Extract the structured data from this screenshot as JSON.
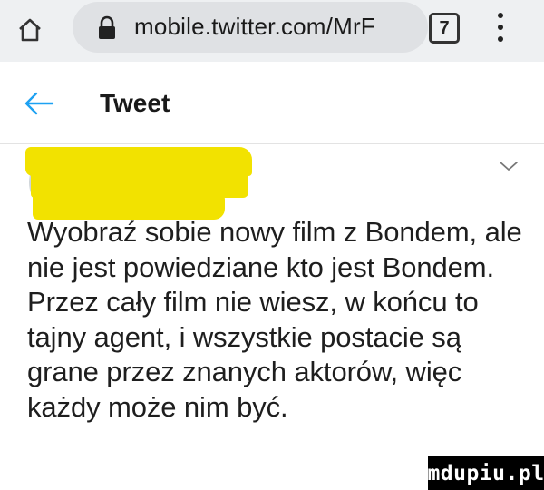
{
  "browser": {
    "url": "mobile.twitter.com/MrF",
    "tab_count": "7",
    "icons": {
      "home": "home-icon",
      "lock": "lock-icon",
      "menu": "kebab-menu-icon"
    }
  },
  "header": {
    "title": "Tweet",
    "back_icon": "arrow-left-icon",
    "accent_color": "#1da1f2"
  },
  "author": {
    "name": "",
    "handle": "",
    "redaction_color": "#f2e200",
    "menu_icon": "chevron-down-icon"
  },
  "tweet": {
    "text": "Wyobraź sobie nowy film z Bondem, ale nie jest powiedziane kto jest Bondem. Przez cały film nie wiesz, w końcu to tajny agent, i wszystkie postacie są grane przez znanych aktorów, więc każdy może nim być."
  },
  "watermark": {
    "text": "mdupiu.pl"
  }
}
